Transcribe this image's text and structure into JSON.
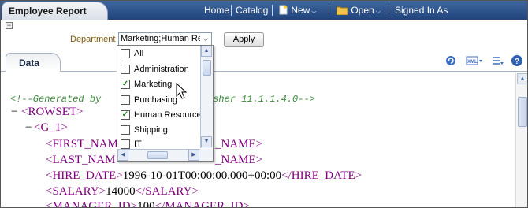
{
  "header": {
    "title": "Employee Report",
    "nav": [
      {
        "label": "Home"
      },
      {
        "label": "Catalog"
      },
      {
        "label": "New"
      },
      {
        "label": "Open"
      },
      {
        "label": "Signed In As"
      }
    ]
  },
  "params": {
    "label": "Department",
    "selected_value": "Marketing;Human Res",
    "apply_label": "Apply"
  },
  "dropdown": {
    "options": [
      {
        "label": "All",
        "checked": false
      },
      {
        "label": "Administration",
        "checked": false
      },
      {
        "label": "Marketing",
        "checked": true
      },
      {
        "label": "Purchasing",
        "checked": false
      },
      {
        "label": "Human Resources",
        "checked": true
      },
      {
        "label": "Shipping",
        "checked": false
      },
      {
        "label": "IT",
        "checked": false
      }
    ]
  },
  "tabs": {
    "data_label": "Data"
  },
  "xml": {
    "comment_left": "<!--Generated by",
    "comment_right": "sher 11.1.1.4.0-->",
    "rowset": "ROWSET",
    "group": "G_1",
    "first_name_tag": "FIRST_NAM",
    "first_name_close": "_NAME",
    "last_name_tag": "LAST_NAM",
    "last_name_close": "_NAME",
    "hire_date_tag": "HIRE_DATE",
    "hire_date_value": "1996-10-01T00:00:00.000+00:00",
    "salary_tag": "SALARY",
    "salary_value": "14000",
    "manager_tag": "MANAGER_ID",
    "manager_value": "100"
  },
  "colors": {
    "header": "#2b4f86",
    "tag": "#800080",
    "comment": "#3a8a3a",
    "checkmark": "#1a7a1a"
  }
}
